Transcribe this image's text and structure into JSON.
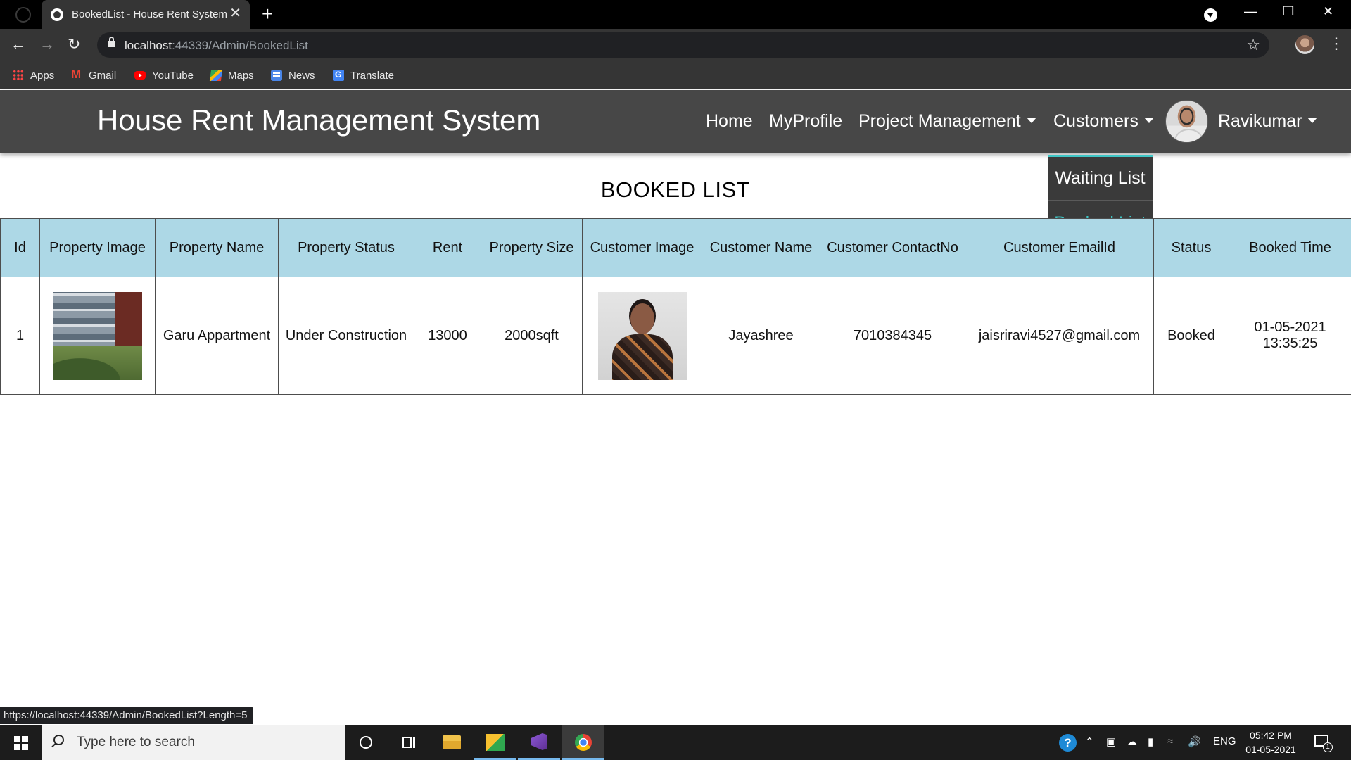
{
  "browser": {
    "tab_title": "BookedList - House Rent System",
    "tab_close": "✕",
    "new_tab": "+",
    "url_host": "localhost",
    "url_rest": ":44339/Admin/BookedList",
    "bookmarks": [
      {
        "label": "Apps",
        "icon": "apps-icon"
      },
      {
        "label": "Gmail",
        "icon": "gmail-icon"
      },
      {
        "label": "YouTube",
        "icon": "youtube-icon"
      },
      {
        "label": "Maps",
        "icon": "maps-icon"
      },
      {
        "label": "News",
        "icon": "news-icon"
      },
      {
        "label": "Translate",
        "icon": "translate-icon"
      }
    ],
    "status_url": "https://localhost:44339/Admin/BookedList?Length=5"
  },
  "navbar": {
    "brand": "House Rent Management System",
    "links": {
      "home": "Home",
      "myprofile": "MyProfile",
      "project_management": "Project Management",
      "customers": "Customers",
      "user": "Ravikumar"
    },
    "customers_menu": [
      "Waiting List",
      "Booked List"
    ],
    "active_menu_item": "Booked List",
    "accent_color": "#3ec6c6"
  },
  "page": {
    "heading": "BOOKED LIST",
    "table": {
      "headers": [
        "Id",
        "Property Image",
        "Property Name",
        "Property Status",
        "Rent",
        "Property Size",
        "Customer Image",
        "Customer Name",
        "Customer ContactNo",
        "Customer EmailId",
        "Status",
        "Booked Time"
      ],
      "rows": [
        {
          "id": "1",
          "property_name": "Garu Appartment",
          "property_status": "Under Construction",
          "rent": "13000",
          "property_size": "2000sqft",
          "customer_name": "Jayashree",
          "customer_contact": "7010384345",
          "customer_email": "jaisriravi4527@gmail.com",
          "status": "Booked",
          "booked_time": "01-05-2021 13:35:25"
        }
      ]
    },
    "header_bg": "#add8e6",
    "status_color": "#2e8b2e"
  },
  "taskbar": {
    "search_placeholder": "Type here to search",
    "language": "ENG",
    "time": "05:42 PM",
    "date": "01-05-2021",
    "notification_count": "1"
  }
}
